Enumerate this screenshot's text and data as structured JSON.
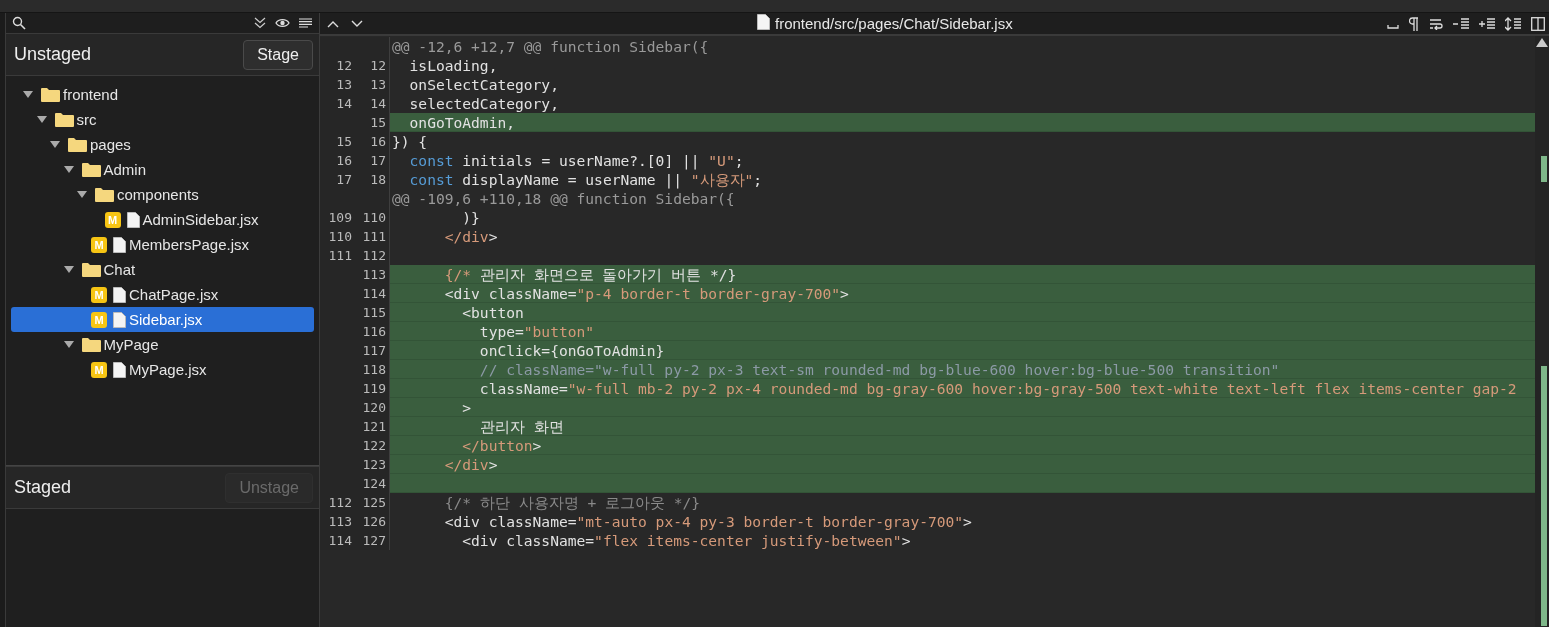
{
  "unstaged": {
    "title": "Unstaged",
    "button": {
      "label": "Stage",
      "disabled": false
    },
    "tree": [
      {
        "kind": "folder",
        "name": "frontend",
        "expanded": true,
        "selected": false,
        "children": [
          {
            "kind": "folder",
            "name": "src",
            "expanded": true,
            "selected": false,
            "children": [
              {
                "kind": "folder",
                "name": "pages",
                "expanded": true,
                "selected": false,
                "children": [
                  {
                    "kind": "folder",
                    "name": "Admin",
                    "expanded": true,
                    "selected": false,
                    "children": [
                      {
                        "kind": "folder",
                        "name": "components",
                        "expanded": true,
                        "selected": false,
                        "children": [
                          {
                            "kind": "file",
                            "name": "AdminSidebar.jsx",
                            "status": "M",
                            "selected": false
                          }
                        ]
                      },
                      {
                        "kind": "file",
                        "name": "MembersPage.jsx",
                        "status": "M",
                        "selected": false
                      }
                    ]
                  },
                  {
                    "kind": "folder",
                    "name": "Chat",
                    "expanded": true,
                    "selected": false,
                    "children": [
                      {
                        "kind": "file",
                        "name": "ChatPage.jsx",
                        "status": "M",
                        "selected": false
                      },
                      {
                        "kind": "file",
                        "name": "Sidebar.jsx",
                        "status": "M",
                        "selected": true
                      }
                    ]
                  },
                  {
                    "kind": "folder",
                    "name": "MyPage",
                    "expanded": true,
                    "selected": false,
                    "children": [
                      {
                        "kind": "file",
                        "name": "MyPage.jsx",
                        "status": "M",
                        "selected": false
                      }
                    ]
                  }
                ]
              }
            ]
          }
        ]
      }
    ]
  },
  "staged": {
    "title": "Staged",
    "button": {
      "label": "Unstage",
      "disabled": true
    }
  },
  "diff_toolbar": {
    "file_path": "frontend/src/pages/Chat/Sidebar.jsx"
  },
  "diff": {
    "lines": [
      {
        "kind": "hunk",
        "text": "@@ -12,6 +12,7 @@ function Sidebar({"
      },
      {
        "kind": "context",
        "old": "12",
        "new": "12",
        "tokens": [
          {
            "kind": "plain",
            "text": "  isLoading,"
          }
        ]
      },
      {
        "kind": "context",
        "old": "13",
        "new": "13",
        "tokens": [
          {
            "kind": "plain",
            "text": "  onSelectCategory,"
          }
        ]
      },
      {
        "kind": "context",
        "old": "14",
        "new": "14",
        "tokens": [
          {
            "kind": "plain",
            "text": "  selectedCategory,"
          }
        ]
      },
      {
        "kind": "added",
        "new": "15",
        "tokens": [
          {
            "kind": "plain",
            "text": "  onGoToAdmin,"
          }
        ]
      },
      {
        "kind": "context",
        "old": "15",
        "new": "16",
        "tokens": [
          {
            "kind": "plain",
            "text": "}) {"
          }
        ]
      },
      {
        "kind": "context",
        "old": "16",
        "new": "17",
        "tokens": [
          {
            "kind": "keyword",
            "text": "  const"
          },
          {
            "kind": "plain",
            "text": " initials = userName?.[0] || "
          },
          {
            "kind": "string",
            "text": "\"U\""
          },
          {
            "kind": "plain",
            "text": ";"
          }
        ]
      },
      {
        "kind": "context",
        "old": "17",
        "new": "18",
        "tokens": [
          {
            "kind": "keyword",
            "text": "  const"
          },
          {
            "kind": "plain",
            "text": " displayName = userName || "
          },
          {
            "kind": "string",
            "text": "\"사용자\""
          },
          {
            "kind": "plain",
            "text": ";"
          }
        ]
      },
      {
        "kind": "hunk",
        "text": "@@ -109,6 +110,18 @@ function Sidebar({"
      },
      {
        "kind": "context",
        "old": "109",
        "new": "110",
        "tokens": [
          {
            "kind": "plain",
            "text": "        )}"
          }
        ]
      },
      {
        "kind": "context",
        "old": "110",
        "new": "111",
        "tokens": [
          {
            "kind": "tag",
            "text": "      </div"
          },
          {
            "kind": "plain",
            "text": ">"
          }
        ]
      },
      {
        "kind": "context",
        "old": "111",
        "new": "112"
      },
      {
        "kind": "added",
        "new": "113",
        "tokens": [
          {
            "kind": "tag",
            "text": "      {/*"
          },
          {
            "kind": "plain",
            "text": " 관리자 화면으로 돌아가기 버튼 */}"
          }
        ]
      },
      {
        "kind": "added",
        "new": "114",
        "tokens": [
          {
            "kind": "plain",
            "text": "      <div className="
          },
          {
            "kind": "string",
            "text": "\"p-4 border-t border-gray-700\""
          },
          {
            "kind": "plain",
            "text": ">"
          }
        ]
      },
      {
        "kind": "added",
        "new": "115",
        "tokens": [
          {
            "kind": "plain",
            "text": "        <button"
          }
        ]
      },
      {
        "kind": "added",
        "new": "116",
        "tokens": [
          {
            "kind": "plain",
            "text": "          type="
          },
          {
            "kind": "string",
            "text": "\"button\""
          }
        ]
      },
      {
        "kind": "added",
        "new": "117",
        "tokens": [
          {
            "kind": "plain",
            "text": "          onClick={onGoToAdmin}"
          }
        ]
      },
      {
        "kind": "added",
        "new": "118",
        "tokens": [
          {
            "kind": "comment",
            "text": "          // className=\"w-full py-2 px-3 text-sm rounded-md bg-blue-600 hover:bg-blue-500 transition\""
          }
        ]
      },
      {
        "kind": "added",
        "new": "119",
        "tokens": [
          {
            "kind": "plain",
            "text": "          className="
          },
          {
            "kind": "string",
            "text": "\"w-full mb-2 py-2 px-4 rounded-md bg-gray-600 hover:bg-gray-500 text-white text-left flex items-center gap-2"
          }
        ]
      },
      {
        "kind": "added",
        "new": "120",
        "tokens": [
          {
            "kind": "plain",
            "text": "        >"
          }
        ]
      },
      {
        "kind": "added",
        "new": "121",
        "tokens": [
          {
            "kind": "plain",
            "text": "          관리자 화면"
          }
        ]
      },
      {
        "kind": "added",
        "new": "122",
        "tokens": [
          {
            "kind": "tag",
            "text": "        </button"
          },
          {
            "kind": "plain",
            "text": ">"
          }
        ]
      },
      {
        "kind": "added",
        "new": "123",
        "tokens": [
          {
            "kind": "tag",
            "text": "      </div"
          },
          {
            "kind": "plain",
            "text": ">"
          }
        ]
      },
      {
        "kind": "added",
        "new": "124"
      },
      {
        "kind": "context",
        "old": "112",
        "new": "125",
        "tokens": [
          {
            "kind": "comment",
            "text": "      {/* 하단 사용자명 + 로그아웃 */}"
          }
        ]
      },
      {
        "kind": "context",
        "old": "113",
        "new": "126",
        "tokens": [
          {
            "kind": "plain",
            "text": "      <div className="
          },
          {
            "kind": "string",
            "text": "\"mt-auto px-4 py-3 border-t border-gray-700\""
          },
          {
            "kind": "plain",
            "text": ">"
          }
        ]
      },
      {
        "kind": "context",
        "old": "114",
        "new": "127",
        "tokens": [
          {
            "kind": "plain",
            "text": "        <div className="
          },
          {
            "kind": "string",
            "text": "\"flex items-center justify-between\""
          },
          {
            "kind": "plain",
            "text": ">"
          }
        ]
      }
    ]
  }
}
